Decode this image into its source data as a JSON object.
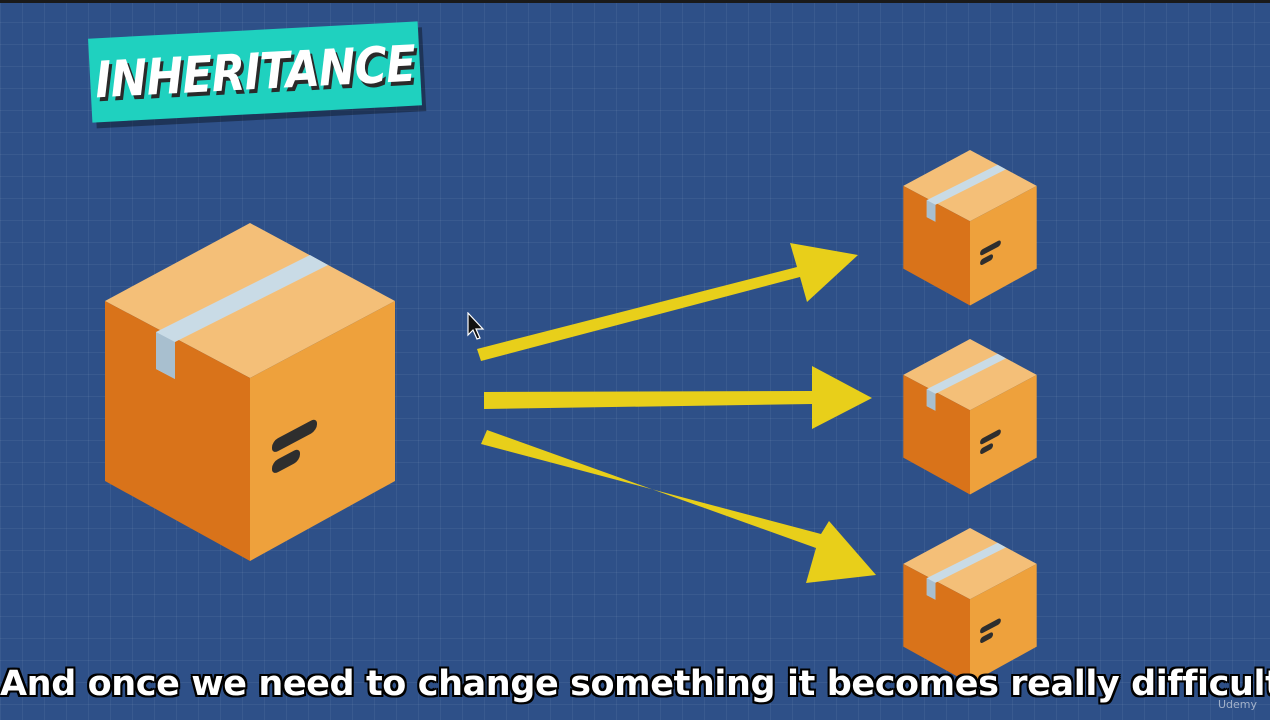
{
  "title": "INHERITANCE",
  "caption": "And once we need to change something it becomes really difficult.",
  "watermark": "Udemy",
  "colors": {
    "background": "#2e5088",
    "banner": "#1fd1bf",
    "arrow": "#e8cf1a",
    "box_top": "#f4bf78",
    "box_left": "#d9731a",
    "box_right": "#eea13c",
    "tape": "#c9dbe6",
    "mark": "#2e2e2e"
  },
  "icons": {
    "parent": "cardboard-box-icon",
    "children": [
      "cardboard-box-icon",
      "cardboard-box-icon",
      "cardboard-box-icon"
    ],
    "arrows": [
      "arrow-right-icon",
      "arrow-right-icon",
      "arrow-right-icon"
    ],
    "pointer": "mouse-pointer-icon"
  }
}
